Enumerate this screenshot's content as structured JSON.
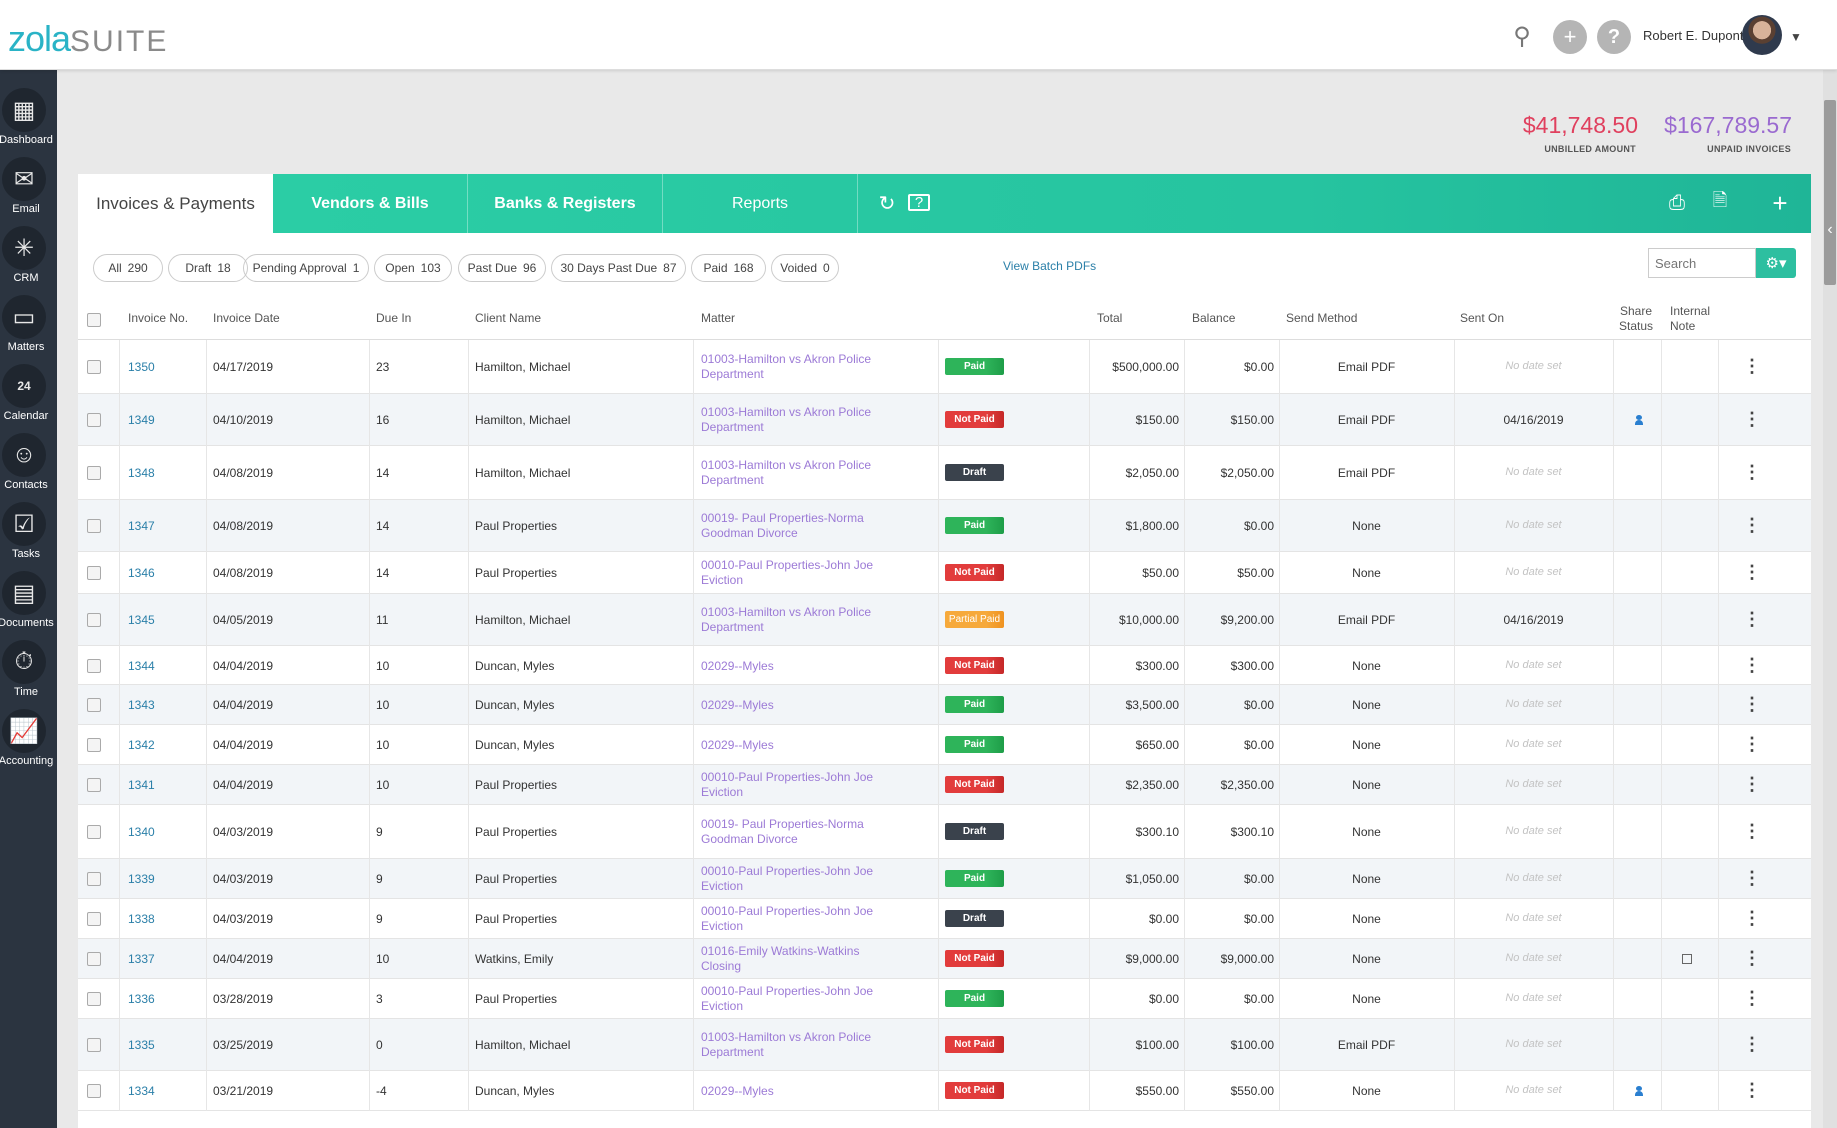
{
  "app": {
    "logo_zola": "zola",
    "logo_suite": "SUITE",
    "username": "Robert E. Dupont"
  },
  "sidebar": {
    "items": [
      {
        "label": "Dashboard",
        "icon": "dashboard-icon",
        "glyph": "▦"
      },
      {
        "label": "Email",
        "icon": "email-icon",
        "glyph": "✉"
      },
      {
        "label": "CRM",
        "icon": "crm-icon",
        "glyph": "✳"
      },
      {
        "label": "Matters",
        "icon": "briefcase-icon",
        "glyph": "▭"
      },
      {
        "label": "Calendar",
        "icon": "calendar-icon",
        "glyph": "24"
      },
      {
        "label": "Contacts",
        "icon": "contacts-icon",
        "glyph": "☺"
      },
      {
        "label": "Tasks",
        "icon": "tasks-icon",
        "glyph": "☑"
      },
      {
        "label": "Documents",
        "icon": "documents-icon",
        "glyph": "▤"
      },
      {
        "label": "Time",
        "icon": "time-icon",
        "glyph": "⏱"
      },
      {
        "label": "Accounting",
        "icon": "accounting-icon",
        "glyph": "📈"
      }
    ]
  },
  "totals": {
    "unbilled_amount": "$41,748.50",
    "unbilled_label": "UNBILLED AMOUNT",
    "unpaid_amount": "$167,789.57",
    "unpaid_label": "UNPAID INVOICES",
    "unbilled_color": "#e0405e",
    "unpaid_color": "#9a6ad0"
  },
  "tabs": {
    "invoices": "Invoices & Payments",
    "vendors": "Vendors & Bills",
    "banks": "Banks & Registers",
    "reports": "Reports"
  },
  "filters": [
    {
      "label": "All",
      "count": "290"
    },
    {
      "label": "Draft",
      "count": "18"
    },
    {
      "label": "Pending Approval",
      "count": "1"
    },
    {
      "label": "Open",
      "count": "103"
    },
    {
      "label": "Past Due",
      "count": "96"
    },
    {
      "label": "30 Days Past Due",
      "count": "87"
    },
    {
      "label": "Paid",
      "count": "168"
    },
    {
      "label": "Voided",
      "count": "0"
    }
  ],
  "view_batch_pdfs": "View Batch PDFs",
  "search": {
    "placeholder": "Search"
  },
  "columns": {
    "invoice_no": "Invoice No.",
    "invoice_date": "Invoice Date",
    "due_in": "Due In",
    "client_name": "Client Name",
    "matter": "Matter",
    "total": "Total",
    "balance": "Balance",
    "send_method": "Send Method",
    "sent_on": "Sent On",
    "share_status_1": "Share",
    "share_status_2": "Status",
    "internal_note_1": "Internal",
    "internal_note_2": "Note"
  },
  "rows": [
    {
      "no": "1350",
      "date": "04/17/2019",
      "due": "23",
      "client": "Hamilton, Michael",
      "matter": "01003-Hamilton vs Akron Police Department",
      "status": "Paid",
      "total": "$500,000.00",
      "balance": "$0.00",
      "method": "Email PDF",
      "sent": "No date set",
      "share": false,
      "note": false
    },
    {
      "no": "1349",
      "date": "04/10/2019",
      "due": "16",
      "client": "Hamilton, Michael",
      "matter": "01003-Hamilton vs Akron Police Department",
      "status": "Not Paid",
      "total": "$150.00",
      "balance": "$150.00",
      "method": "Email PDF",
      "sent": "04/16/2019",
      "share": true,
      "note": false
    },
    {
      "no": "1348",
      "date": "04/08/2019",
      "due": "14",
      "client": "Hamilton, Michael",
      "matter": "01003-Hamilton vs Akron Police Department",
      "status": "Draft",
      "total": "$2,050.00",
      "balance": "$2,050.00",
      "method": "Email PDF",
      "sent": "No date set",
      "share": false,
      "note": false
    },
    {
      "no": "1347",
      "date": "04/08/2019",
      "due": "14",
      "client": "Paul Properties",
      "matter": "00019- Paul Properties-Norma Goodman Divorce",
      "status": "Paid",
      "total": "$1,800.00",
      "balance": "$0.00",
      "method": "None",
      "sent": "No date set",
      "share": false,
      "note": false
    },
    {
      "no": "1346",
      "date": "04/08/2019",
      "due": "14",
      "client": "Paul Properties",
      "matter": "00010-Paul Properties-John Joe Eviction",
      "status": "Not Paid",
      "total": "$50.00",
      "balance": "$50.00",
      "method": "None",
      "sent": "No date set",
      "share": false,
      "note": false
    },
    {
      "no": "1345",
      "date": "04/05/2019",
      "due": "11",
      "client": "Hamilton, Michael",
      "matter": "01003-Hamilton vs Akron Police Department",
      "status": "Partial Paid",
      "total": "$10,000.00",
      "balance": "$9,200.00",
      "method": "Email PDF",
      "sent": "04/16/2019",
      "share": false,
      "note": false
    },
    {
      "no": "1344",
      "date": "04/04/2019",
      "due": "10",
      "client": "Duncan, Myles",
      "matter": "02029--Myles",
      "status": "Not Paid",
      "total": "$300.00",
      "balance": "$300.00",
      "method": "None",
      "sent": "No date set",
      "share": false,
      "note": false
    },
    {
      "no": "1343",
      "date": "04/04/2019",
      "due": "10",
      "client": "Duncan, Myles",
      "matter": "02029--Myles",
      "status": "Paid",
      "total": "$3,500.00",
      "balance": "$0.00",
      "method": "None",
      "sent": "No date set",
      "share": false,
      "note": false
    },
    {
      "no": "1342",
      "date": "04/04/2019",
      "due": "10",
      "client": "Duncan, Myles",
      "matter": "02029--Myles",
      "status": "Paid",
      "total": "$650.00",
      "balance": "$0.00",
      "method": "None",
      "sent": "No date set",
      "share": false,
      "note": false
    },
    {
      "no": "1341",
      "date": "04/04/2019",
      "due": "10",
      "client": "Paul Properties",
      "matter": "00010-Paul Properties-John Joe Eviction",
      "status": "Not Paid",
      "total": "$2,350.00",
      "balance": "$2,350.00",
      "method": "None",
      "sent": "No date set",
      "share": false,
      "note": false
    },
    {
      "no": "1340",
      "date": "04/03/2019",
      "due": "9",
      "client": "Paul Properties",
      "matter": "00019- Paul Properties-Norma Goodman Divorce",
      "status": "Draft",
      "total": "$300.10",
      "balance": "$300.10",
      "method": "None",
      "sent": "No date set",
      "share": false,
      "note": false
    },
    {
      "no": "1339",
      "date": "04/03/2019",
      "due": "9",
      "client": "Paul Properties",
      "matter": "00010-Paul Properties-John Joe Eviction",
      "status": "Paid",
      "total": "$1,050.00",
      "balance": "$0.00",
      "method": "None",
      "sent": "No date set",
      "share": false,
      "note": false
    },
    {
      "no": "1338",
      "date": "04/03/2019",
      "due": "9",
      "client": "Paul Properties",
      "matter": "00010-Paul Properties-John Joe Eviction",
      "status": "Draft",
      "total": "$0.00",
      "balance": "$0.00",
      "method": "None",
      "sent": "No date set",
      "share": false,
      "note": false
    },
    {
      "no": "1337",
      "date": "04/04/2019",
      "due": "10",
      "client": "Watkins, Emily",
      "matter": "01016-Emily Watkins-Watkins Closing",
      "status": "Not Paid",
      "total": "$9,000.00",
      "balance": "$9,000.00",
      "method": "None",
      "sent": "No date set",
      "share": false,
      "note": true
    },
    {
      "no": "1336",
      "date": "03/28/2019",
      "due": "3",
      "client": "Paul Properties",
      "matter": "00010-Paul Properties-John Joe Eviction",
      "status": "Paid",
      "total": "$0.00",
      "balance": "$0.00",
      "method": "None",
      "sent": "No date set",
      "share": false,
      "note": false
    },
    {
      "no": "1335",
      "date": "03/25/2019",
      "due": "0",
      "client": "Hamilton, Michael",
      "matter": "01003-Hamilton vs Akron Police Department",
      "status": "Not Paid",
      "total": "$100.00",
      "balance": "$100.00",
      "method": "Email PDF",
      "sent": "No date set",
      "share": false,
      "note": false
    },
    {
      "no": "1334",
      "date": "03/21/2019",
      "due": "-4",
      "client": "Duncan, Myles",
      "matter": "02029--Myles",
      "status": "Not Paid",
      "total": "$550.00",
      "balance": "$550.00",
      "method": "None",
      "sent": "No date set",
      "share": true,
      "note": false
    }
  ]
}
